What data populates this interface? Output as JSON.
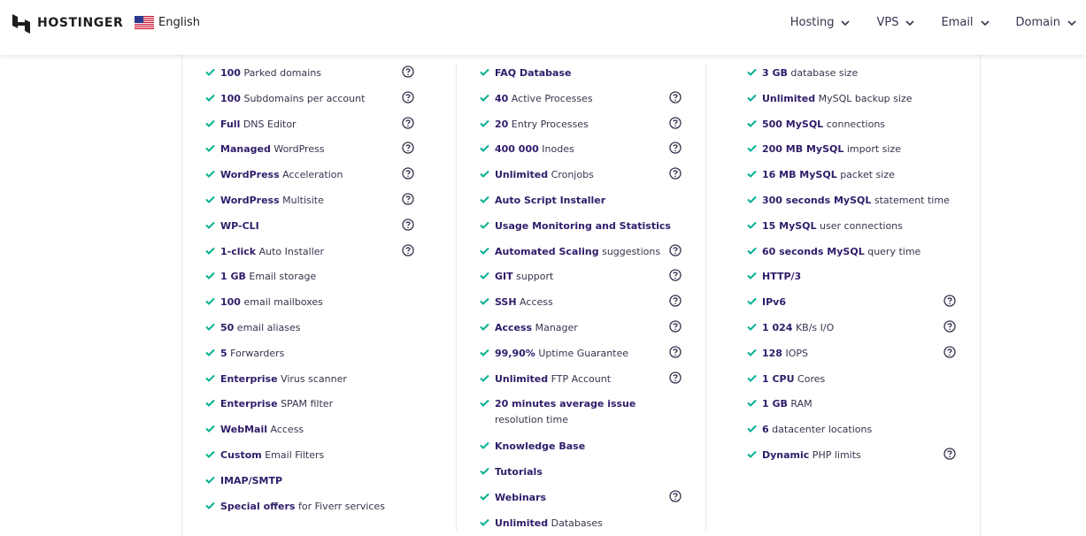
{
  "header": {
    "brand": "HOSTINGER",
    "language": "English",
    "nav": [
      {
        "label": "Hosting"
      },
      {
        "label": "VPS"
      },
      {
        "label": "Email"
      },
      {
        "label": "Domain"
      }
    ]
  },
  "columns": [
    {
      "items": [
        {
          "bold": "100",
          "rest": " Parked domains",
          "help": true
        },
        {
          "bold": "100",
          "rest": " Subdomains per account",
          "help": true
        },
        {
          "bold": "Full",
          "rest": " DNS Editor",
          "help": true
        },
        {
          "bold": "Managed",
          "rest": " WordPress",
          "help": true
        },
        {
          "bold": "WordPress",
          "rest": " Acceleration",
          "help": true
        },
        {
          "bold": "WordPress",
          "rest": " Multisite",
          "help": true
        },
        {
          "bold": "WP-CLI",
          "rest": "",
          "help": true
        },
        {
          "bold": "1-click",
          "rest": " Auto Installer",
          "help": true
        },
        {
          "bold": "1 GB",
          "rest": " Email storage",
          "help": false
        },
        {
          "bold": "100",
          "rest": " email mailboxes",
          "help": false
        },
        {
          "bold": "50",
          "rest": " email aliases",
          "help": false
        },
        {
          "bold": "5",
          "rest": " Forwarders",
          "help": false
        },
        {
          "bold": "Enterprise",
          "rest": " Virus scanner",
          "help": false
        },
        {
          "bold": "Enterprise",
          "rest": " SPAM filter",
          "help": false
        },
        {
          "bold": "WebMail",
          "rest": " Access",
          "help": false
        },
        {
          "bold": "Custom",
          "rest": " Email Filters",
          "help": false
        },
        {
          "bold": "IMAP/SMTP",
          "rest": "",
          "help": false
        },
        {
          "bold": "Special offers",
          "rest": " for Fiverr services",
          "help": false
        }
      ]
    },
    {
      "items": [
        {
          "bold": "FAQ Database",
          "rest": "",
          "help": false
        },
        {
          "bold": "40",
          "rest": " Active Processes",
          "help": true
        },
        {
          "bold": "20",
          "rest": " Entry Processes",
          "help": true
        },
        {
          "bold": "400 000",
          "rest": " Inodes",
          "help": true
        },
        {
          "bold": "Unlimited",
          "rest": " Cronjobs",
          "help": true
        },
        {
          "bold": "Auto Script Installer",
          "rest": "",
          "help": false
        },
        {
          "bold": "Usage Monitoring and Statistics",
          "rest": "",
          "help": false
        },
        {
          "bold": "Automated Scaling",
          "rest": " suggestions",
          "help": true
        },
        {
          "bold": "GIT",
          "rest": " support",
          "help": true
        },
        {
          "bold": "SSH",
          "rest": " Access",
          "help": true
        },
        {
          "bold": "Access",
          "rest": " Manager",
          "help": true
        },
        {
          "bold": "99,90%",
          "rest": " Uptime Guarantee",
          "help": true
        },
        {
          "bold": "Unlimited",
          "rest": " FTP Account",
          "help": true
        },
        {
          "bold": "20 minutes average issue",
          "rest": " resolution time",
          "help": false,
          "tall": true
        },
        {
          "bold": "Knowledge Base",
          "rest": "",
          "help": false
        },
        {
          "bold": "Tutorials",
          "rest": "",
          "help": false
        },
        {
          "bold": "Webinars",
          "rest": "",
          "help": true
        },
        {
          "bold": "Unlimited",
          "rest": " Databases",
          "help": false
        }
      ]
    },
    {
      "items": [
        {
          "bold": "3 GB",
          "rest": " database size",
          "help": false
        },
        {
          "bold": "Unlimited",
          "rest": " MySQL backup size",
          "help": false
        },
        {
          "bold": "500 MySQL",
          "rest": " connections",
          "help": false
        },
        {
          "bold": "200 MB MySQL",
          "rest": " import size",
          "help": false
        },
        {
          "bold": "16 MB MySQL",
          "rest": " packet size",
          "help": false
        },
        {
          "bold": "300 seconds MySQL",
          "rest": " statement time",
          "help": false
        },
        {
          "bold": "15 MySQL",
          "rest": " user connections",
          "help": false
        },
        {
          "bold": "60 seconds MySQL",
          "rest": " query time",
          "help": false
        },
        {
          "bold": "HTTP/3",
          "rest": "",
          "help": false
        },
        {
          "bold": "IPv6",
          "rest": "",
          "help": true
        },
        {
          "bold": "1 024",
          "rest": " KB/s I/O",
          "help": true
        },
        {
          "bold": "128",
          "rest": " IOPS",
          "help": true
        },
        {
          "bold": "1 CPU",
          "rest": " Cores",
          "help": false
        },
        {
          "bold": "1 GB",
          "rest": " RAM",
          "help": false
        },
        {
          "bold": "6",
          "rest": " datacenter locations",
          "help": false
        },
        {
          "bold": "Dynamic",
          "rest": " PHP limits",
          "help": true
        }
      ]
    }
  ],
  "colors": {
    "check": "#00b090",
    "heading_text": "#2f1c6a",
    "body_text": "#36344d",
    "divider": "#e5e5ee"
  }
}
